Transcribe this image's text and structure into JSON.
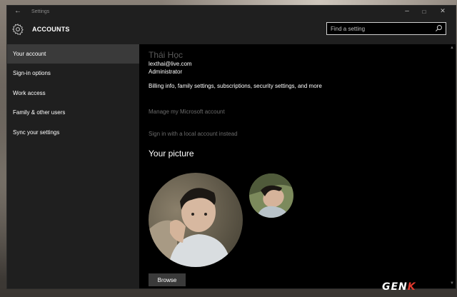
{
  "window": {
    "title": "Settings"
  },
  "header": {
    "app_title": "ACCOUNTS",
    "search_placeholder": "Find a setting"
  },
  "sidebar": {
    "items": [
      {
        "label": "Your account",
        "active": true
      },
      {
        "label": "Sign-in options",
        "active": false
      },
      {
        "label": "Work access",
        "active": false
      },
      {
        "label": "Family & other users",
        "active": false
      },
      {
        "label": "Sync your settings",
        "active": false
      }
    ]
  },
  "account": {
    "name": "Thái Học",
    "email": "lexthai@live.com",
    "role": "Administrator",
    "description": "Billing info, family settings, subscriptions, security settings, and more",
    "manage_link": "Manage my Microsoft account",
    "local_link": "Sign in with a local account instead"
  },
  "picture": {
    "heading": "Your picture",
    "browse_label": "Browse"
  },
  "watermark": {
    "text": "GEN",
    "accent": "K"
  },
  "colors": {
    "window_bg": "#000000",
    "sidebar_bg": "#1f1f1f",
    "active_item": "#3a3a3a",
    "link_gray": "#6b6b6b",
    "watermark_accent": "#e23a2e"
  }
}
